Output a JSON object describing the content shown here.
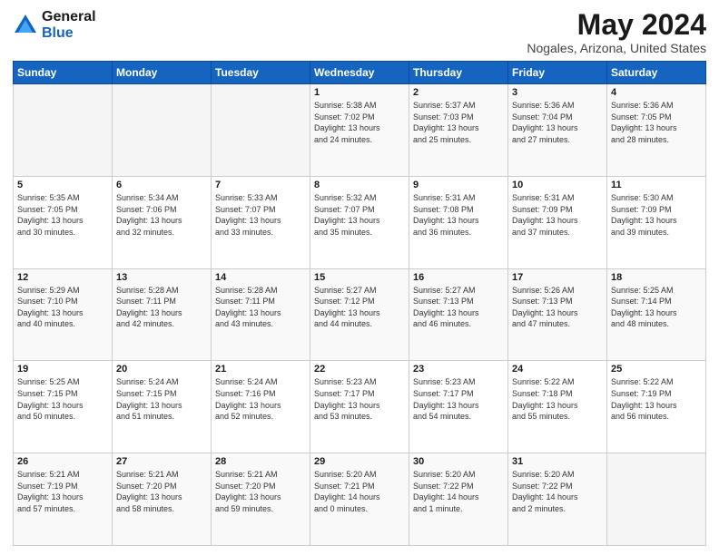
{
  "header": {
    "logo_general": "General",
    "logo_blue": "Blue",
    "title": "May 2024",
    "subtitle": "Nogales, Arizona, United States"
  },
  "weekdays": [
    "Sunday",
    "Monday",
    "Tuesday",
    "Wednesday",
    "Thursday",
    "Friday",
    "Saturday"
  ],
  "weeks": [
    [
      {
        "day": "",
        "info": ""
      },
      {
        "day": "",
        "info": ""
      },
      {
        "day": "",
        "info": ""
      },
      {
        "day": "1",
        "info": "Sunrise: 5:38 AM\nSunset: 7:02 PM\nDaylight: 13 hours\nand 24 minutes."
      },
      {
        "day": "2",
        "info": "Sunrise: 5:37 AM\nSunset: 7:03 PM\nDaylight: 13 hours\nand 25 minutes."
      },
      {
        "day": "3",
        "info": "Sunrise: 5:36 AM\nSunset: 7:04 PM\nDaylight: 13 hours\nand 27 minutes."
      },
      {
        "day": "4",
        "info": "Sunrise: 5:36 AM\nSunset: 7:05 PM\nDaylight: 13 hours\nand 28 minutes."
      }
    ],
    [
      {
        "day": "5",
        "info": "Sunrise: 5:35 AM\nSunset: 7:05 PM\nDaylight: 13 hours\nand 30 minutes."
      },
      {
        "day": "6",
        "info": "Sunrise: 5:34 AM\nSunset: 7:06 PM\nDaylight: 13 hours\nand 32 minutes."
      },
      {
        "day": "7",
        "info": "Sunrise: 5:33 AM\nSunset: 7:07 PM\nDaylight: 13 hours\nand 33 minutes."
      },
      {
        "day": "8",
        "info": "Sunrise: 5:32 AM\nSunset: 7:07 PM\nDaylight: 13 hours\nand 35 minutes."
      },
      {
        "day": "9",
        "info": "Sunrise: 5:31 AM\nSunset: 7:08 PM\nDaylight: 13 hours\nand 36 minutes."
      },
      {
        "day": "10",
        "info": "Sunrise: 5:31 AM\nSunset: 7:09 PM\nDaylight: 13 hours\nand 37 minutes."
      },
      {
        "day": "11",
        "info": "Sunrise: 5:30 AM\nSunset: 7:09 PM\nDaylight: 13 hours\nand 39 minutes."
      }
    ],
    [
      {
        "day": "12",
        "info": "Sunrise: 5:29 AM\nSunset: 7:10 PM\nDaylight: 13 hours\nand 40 minutes."
      },
      {
        "day": "13",
        "info": "Sunrise: 5:28 AM\nSunset: 7:11 PM\nDaylight: 13 hours\nand 42 minutes."
      },
      {
        "day": "14",
        "info": "Sunrise: 5:28 AM\nSunset: 7:11 PM\nDaylight: 13 hours\nand 43 minutes."
      },
      {
        "day": "15",
        "info": "Sunrise: 5:27 AM\nSunset: 7:12 PM\nDaylight: 13 hours\nand 44 minutes."
      },
      {
        "day": "16",
        "info": "Sunrise: 5:27 AM\nSunset: 7:13 PM\nDaylight: 13 hours\nand 46 minutes."
      },
      {
        "day": "17",
        "info": "Sunrise: 5:26 AM\nSunset: 7:13 PM\nDaylight: 13 hours\nand 47 minutes."
      },
      {
        "day": "18",
        "info": "Sunrise: 5:25 AM\nSunset: 7:14 PM\nDaylight: 13 hours\nand 48 minutes."
      }
    ],
    [
      {
        "day": "19",
        "info": "Sunrise: 5:25 AM\nSunset: 7:15 PM\nDaylight: 13 hours\nand 50 minutes."
      },
      {
        "day": "20",
        "info": "Sunrise: 5:24 AM\nSunset: 7:15 PM\nDaylight: 13 hours\nand 51 minutes."
      },
      {
        "day": "21",
        "info": "Sunrise: 5:24 AM\nSunset: 7:16 PM\nDaylight: 13 hours\nand 52 minutes."
      },
      {
        "day": "22",
        "info": "Sunrise: 5:23 AM\nSunset: 7:17 PM\nDaylight: 13 hours\nand 53 minutes."
      },
      {
        "day": "23",
        "info": "Sunrise: 5:23 AM\nSunset: 7:17 PM\nDaylight: 13 hours\nand 54 minutes."
      },
      {
        "day": "24",
        "info": "Sunrise: 5:22 AM\nSunset: 7:18 PM\nDaylight: 13 hours\nand 55 minutes."
      },
      {
        "day": "25",
        "info": "Sunrise: 5:22 AM\nSunset: 7:19 PM\nDaylight: 13 hours\nand 56 minutes."
      }
    ],
    [
      {
        "day": "26",
        "info": "Sunrise: 5:21 AM\nSunset: 7:19 PM\nDaylight: 13 hours\nand 57 minutes."
      },
      {
        "day": "27",
        "info": "Sunrise: 5:21 AM\nSunset: 7:20 PM\nDaylight: 13 hours\nand 58 minutes."
      },
      {
        "day": "28",
        "info": "Sunrise: 5:21 AM\nSunset: 7:20 PM\nDaylight: 13 hours\nand 59 minutes."
      },
      {
        "day": "29",
        "info": "Sunrise: 5:20 AM\nSunset: 7:21 PM\nDaylight: 14 hours\nand 0 minutes."
      },
      {
        "day": "30",
        "info": "Sunrise: 5:20 AM\nSunset: 7:22 PM\nDaylight: 14 hours\nand 1 minute."
      },
      {
        "day": "31",
        "info": "Sunrise: 5:20 AM\nSunset: 7:22 PM\nDaylight: 14 hours\nand 2 minutes."
      },
      {
        "day": "",
        "info": ""
      }
    ]
  ]
}
